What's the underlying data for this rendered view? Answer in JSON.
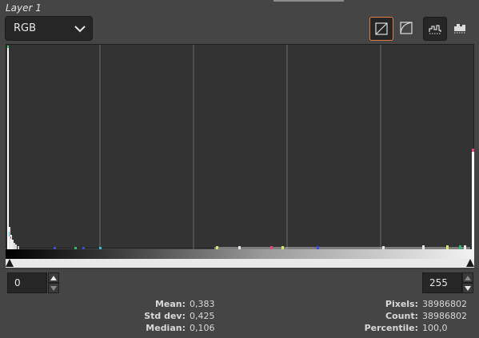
{
  "layer_title": "Layer 1",
  "channel": {
    "value": "RGB",
    "icon": "chevron-down-icon"
  },
  "toolbar": {
    "linear_icon": "linear-histogram-icon",
    "log_icon": "logarithmic-histogram-icon",
    "outline_icon": "histogram-outline-icon",
    "filled_icon": "histogram-filled-icon"
  },
  "range": {
    "low": "0",
    "high": "255"
  },
  "stats": {
    "mean_label": "Mean:",
    "mean_value": "0,383",
    "stddev_label": "Std dev:",
    "stddev_value": "0,425",
    "median_label": "Median:",
    "median_value": "0,106",
    "pixels_label": "Pixels:",
    "pixels_value": "38986802",
    "count_label": "Count:",
    "count_value": "38986802",
    "percentile_label": "Percentile:",
    "percentile_value": "100,0"
  },
  "colors": {
    "accent": "#e07b4c",
    "plot_bg": "#333333",
    "panel_bg": "#454545"
  }
}
